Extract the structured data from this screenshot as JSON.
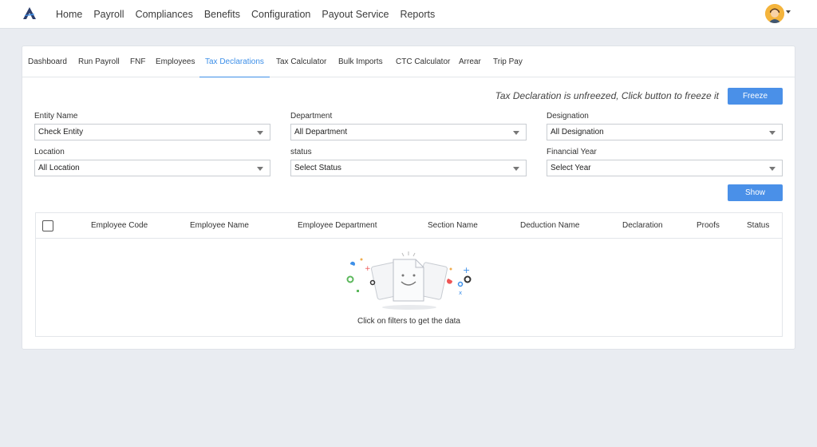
{
  "colors": {
    "accent": "#3d8fe8",
    "button": "#4a90e8",
    "background": "#e9ecf1"
  },
  "topnav": {
    "items": [
      "Home",
      "Payroll",
      "Compliances",
      "Benefits",
      "Configuration",
      "Payout Service",
      "Reports"
    ]
  },
  "tabs": {
    "items": [
      "Dashboard",
      "Run Payroll",
      "FNF",
      "Employees",
      "Tax Declarations",
      "Tax Calculator",
      "Bulk Imports",
      "CTC Calculator",
      "Arrear",
      "Trip Pay"
    ],
    "active": "Tax Declarations"
  },
  "freeze": {
    "message": "Tax Declaration is unfreezed, Click button to freeze it",
    "button": "Freeze"
  },
  "filters": {
    "entity": {
      "label": "Entity Name",
      "value": "Check Entity"
    },
    "department": {
      "label": "Department",
      "value": "All Department"
    },
    "designation": {
      "label": "Designation",
      "value": "All Designation"
    },
    "location": {
      "label": "Location",
      "value": "All Location"
    },
    "status": {
      "label": "status",
      "value": "Select Status"
    },
    "year": {
      "label": "Financial Year",
      "value": "Select Year"
    },
    "show_button": "Show"
  },
  "table": {
    "columns": [
      "Employee Code",
      "Employee Name",
      "Employee Department",
      "Section Name",
      "Deduction Name",
      "Declaration",
      "Proofs",
      "Status"
    ],
    "empty_message": "Click on filters to get the data"
  }
}
